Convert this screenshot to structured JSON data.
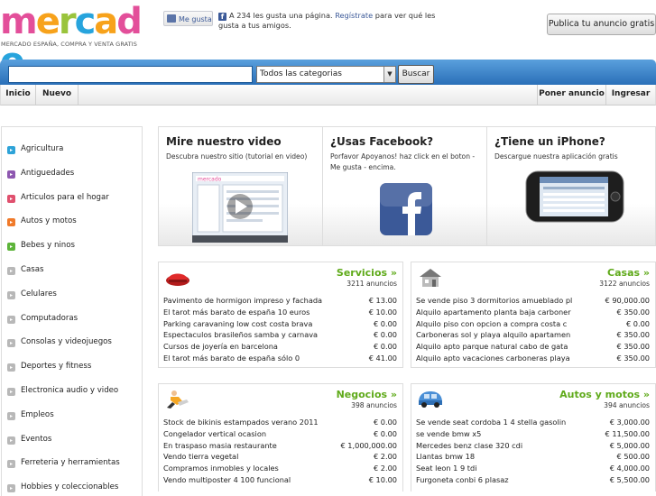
{
  "header": {
    "logo_letters": [
      "m",
      "e",
      "r",
      "c",
      "a",
      "d",
      "o"
    ],
    "logo_colors": [
      "#e34f9a",
      "#f7a21b",
      "#9ac43c",
      "#27a4dd",
      "#f7a21b",
      "#e34f9a",
      "#27a4dd"
    ],
    "logo_tagline": "MERCADO ESPAÑA, COMPRA Y VENTA GRATIS",
    "fb_like_label": "Me gusta",
    "fb_text_pre": "A 234 les gusta una página.",
    "fb_link": "Regístrate",
    "fb_text_post": "para ver qué les gusta a tus amigos.",
    "publish_button": "Publica tu anuncio gratis"
  },
  "search": {
    "input_value": "",
    "category_value": "Todos las categorias",
    "button_label": "Buscar"
  },
  "nav": {
    "inicio": "Inicio",
    "nuevo": "Nuevo",
    "poner_anuncio": "Poner anuncio",
    "ingresar": "Ingresar"
  },
  "sidebar": {
    "items": [
      {
        "label": "Agricultura",
        "color": "#2ea3d8"
      },
      {
        "label": "Antiguedades",
        "color": "#8e58b0"
      },
      {
        "label": "Articulos para el hogar",
        "color": "#e0506e"
      },
      {
        "label": "Autos y motos",
        "color": "#f07a2a"
      },
      {
        "label": "Bebes y ninos",
        "color": "#5db43a"
      },
      {
        "label": "Casas",
        "color": "#b8b8b8"
      },
      {
        "label": "Celulares",
        "color": "#b8b8b8"
      },
      {
        "label": "Computadoras",
        "color": "#b8b8b8"
      },
      {
        "label": "Consolas y videojuegos",
        "color": "#b8b8b8"
      },
      {
        "label": "Deportes y fitness",
        "color": "#b8b8b8"
      },
      {
        "label": "Electronica audio y video",
        "color": "#b8b8b8"
      },
      {
        "label": "Empleos",
        "color": "#b8b8b8"
      },
      {
        "label": "Eventos",
        "color": "#b8b8b8"
      },
      {
        "label": "Ferreteria y herramientas",
        "color": "#b8b8b8"
      },
      {
        "label": "Hobbies y coleccionables",
        "color": "#b8b8b8"
      }
    ]
  },
  "promo": {
    "video": {
      "title": "Mire nuestro video",
      "text": "Descubra nuestro sitio (tutorial en video)"
    },
    "facebook": {
      "title": "¿Usas Facebook?",
      "text": "Porfavor Apoyanos! haz click en el boton - Me gusta - encima."
    },
    "iphone": {
      "title": "¿Tiene un iPhone?",
      "text": "Descargue nuestra aplicación gratis"
    },
    "video_thumb_logo": "mercado"
  },
  "listings": {
    "servicios": {
      "title": "Servicios »",
      "count": "3211 anuncios",
      "rows": [
        {
          "title": "Pavimento de hormigon impreso y fachada",
          "price": "€ 13.00"
        },
        {
          "title": "El tarot más barato de españa 10 euros",
          "price": "€ 10.00"
        },
        {
          "title": "Parking caravaning low cost costa brava",
          "price": "€ 0.00"
        },
        {
          "title": "Espectaculos brasileños samba y carnava",
          "price": "€ 0.00"
        },
        {
          "title": "Cursos de joyería en barcelona",
          "price": "€ 0.00"
        },
        {
          "title": "El tarot más barato de españa sólo 0",
          "price": "€ 41.00"
        }
      ]
    },
    "casas": {
      "title": "Casas »",
      "count": "3122 anuncios",
      "rows": [
        {
          "title": "Se vende piso 3 dormitorios amueblado pl",
          "price": "€ 90,000.00"
        },
        {
          "title": "Alquilo apartamento planta baja carboner",
          "price": "€ 350.00"
        },
        {
          "title": "Alquilo piso con opcion a compra costa c",
          "price": "€ 0.00"
        },
        {
          "title": "Carboneras sol y playa alquilo apartamen",
          "price": "€ 350.00"
        },
        {
          "title": "Alquilo apto parque natural cabo de gata",
          "price": "€ 350.00"
        },
        {
          "title": "Alquilo apto vacaciones carboneras playa",
          "price": "€ 350.00"
        }
      ]
    },
    "negocios": {
      "title": "Negocios »",
      "count": "398 anuncios",
      "rows": [
        {
          "title": "Stock de bikinis estampados verano 2011",
          "price": "€ 0.00"
        },
        {
          "title": "Congelador vertical ocasion",
          "price": "€ 0.00"
        },
        {
          "title": "En traspaso masia restaurante",
          "price": "€ 1,000,000.00"
        },
        {
          "title": "Vendo tierra vegetal",
          "price": "€ 2.00"
        },
        {
          "title": "Compramos inmobles y locales",
          "price": "€ 2.00"
        },
        {
          "title": "Vendo multiposter 4 100 funcional",
          "price": "€ 10.00"
        }
      ]
    },
    "autos": {
      "title": "Autos y motos »",
      "count": "394 anuncios",
      "rows": [
        {
          "title": "Se vende seat cordoba 1 4 stella gasolin",
          "price": "€ 3,000.00"
        },
        {
          "title": "se vende bmw x5",
          "price": "€ 11,500.00"
        },
        {
          "title": "Mercedes benz clase 320 cdi",
          "price": "€ 5,000.00"
        },
        {
          "title": "Llantas bmw 18",
          "price": "€ 500.00"
        },
        {
          "title": "Seat leon 1 9 tdi",
          "price": "€ 4,000.00"
        },
        {
          "title": "Furgoneta conbi 6 plasaz",
          "price": "€ 5,500.00"
        }
      ]
    }
  },
  "colors": {
    "accent_green": "#5faa1a",
    "bar_blue": "#2a6fb8",
    "facebook_blue": "#3b5998"
  }
}
